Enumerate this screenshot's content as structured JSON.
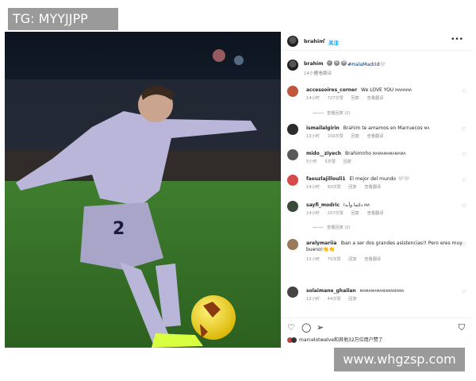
{
  "overlay": {
    "top_label": "TG: MYYJJPP",
    "watermark": "www.whgzsp.com"
  },
  "post": {
    "header": {
      "username": "brahim",
      "dot": "•",
      "follow_label": "关注",
      "more_label": "•••"
    },
    "caption": {
      "username": "brahim",
      "badges": [
        "✓",
        "R",
        "M"
      ],
      "text": "#HalaMadrid🤍",
      "time": "14小时",
      "translate": "查看翻译"
    },
    "comments": [
      {
        "username": "accessoires_corner",
        "text": "We LOVE YOU",
        "small": "MAMAMA",
        "time": "14小时",
        "likes": "727次赞",
        "reply": "回复",
        "translate": "查看翻译",
        "avatar_color": "#c0573a"
      },
      {
        "username": "ismailalgirin",
        "text": "Brahim te amamos en Marruecos",
        "small": "MA",
        "time": "13小时",
        "likes": "150次赞",
        "reply": "回复",
        "translate": "查看翻译",
        "avatar_color": "#2b2b2b"
      },
      {
        "username": "mido__ziyech",
        "text": "Brahimnho",
        "small": "MAMAMAMAMAMA",
        "time": "5小时",
        "likes": "5次赞",
        "reply": "回复",
        "translate": "",
        "avatar_color": "#5a5a5a"
      },
      {
        "username": "faouzlajillouli1",
        "text": "El mejor del mundo 🤍🤍",
        "small": "",
        "time": "14小时",
        "likes": "93次赞",
        "reply": "回复",
        "translate": "查看翻译",
        "avatar_color": "#d64a4a"
      },
      {
        "username": "sayfi_modric",
        "text": "دائما وأبدا",
        "small": "MA",
        "time": "14小时",
        "likes": "207次赞",
        "reply": "回复",
        "translate": "查看翻译",
        "avatar_color": "#3a4a3a"
      },
      {
        "username": "arelymariia",
        "text": "Iban a ser dos grandes asistencias!! Pero eres muy",
        "text2": "bueno!👏👏",
        "small": "",
        "time": "12小时",
        "likes": "70次赞",
        "reply": "回复",
        "translate": "查看翻译",
        "avatar_color": "#9a7a5a"
      },
      {
        "username": "solaimane_ghailan",
        "text": "",
        "small": "MAMAMAMAMAMAMAMA",
        "time": "12小时",
        "likes": "44次赞",
        "reply": "回复",
        "translate": "",
        "avatar_color": "#444444"
      }
    ],
    "view_replies": [
      {
        "label": "查看回复 (2)"
      },
      {
        "label": "查看回复 (2)"
      }
    ],
    "likes_line": "marcelotwelve和其他32万位用户赞了",
    "icons": {
      "heart": "♡",
      "comment": "◯",
      "share": "➢",
      "save": "⛉"
    }
  }
}
